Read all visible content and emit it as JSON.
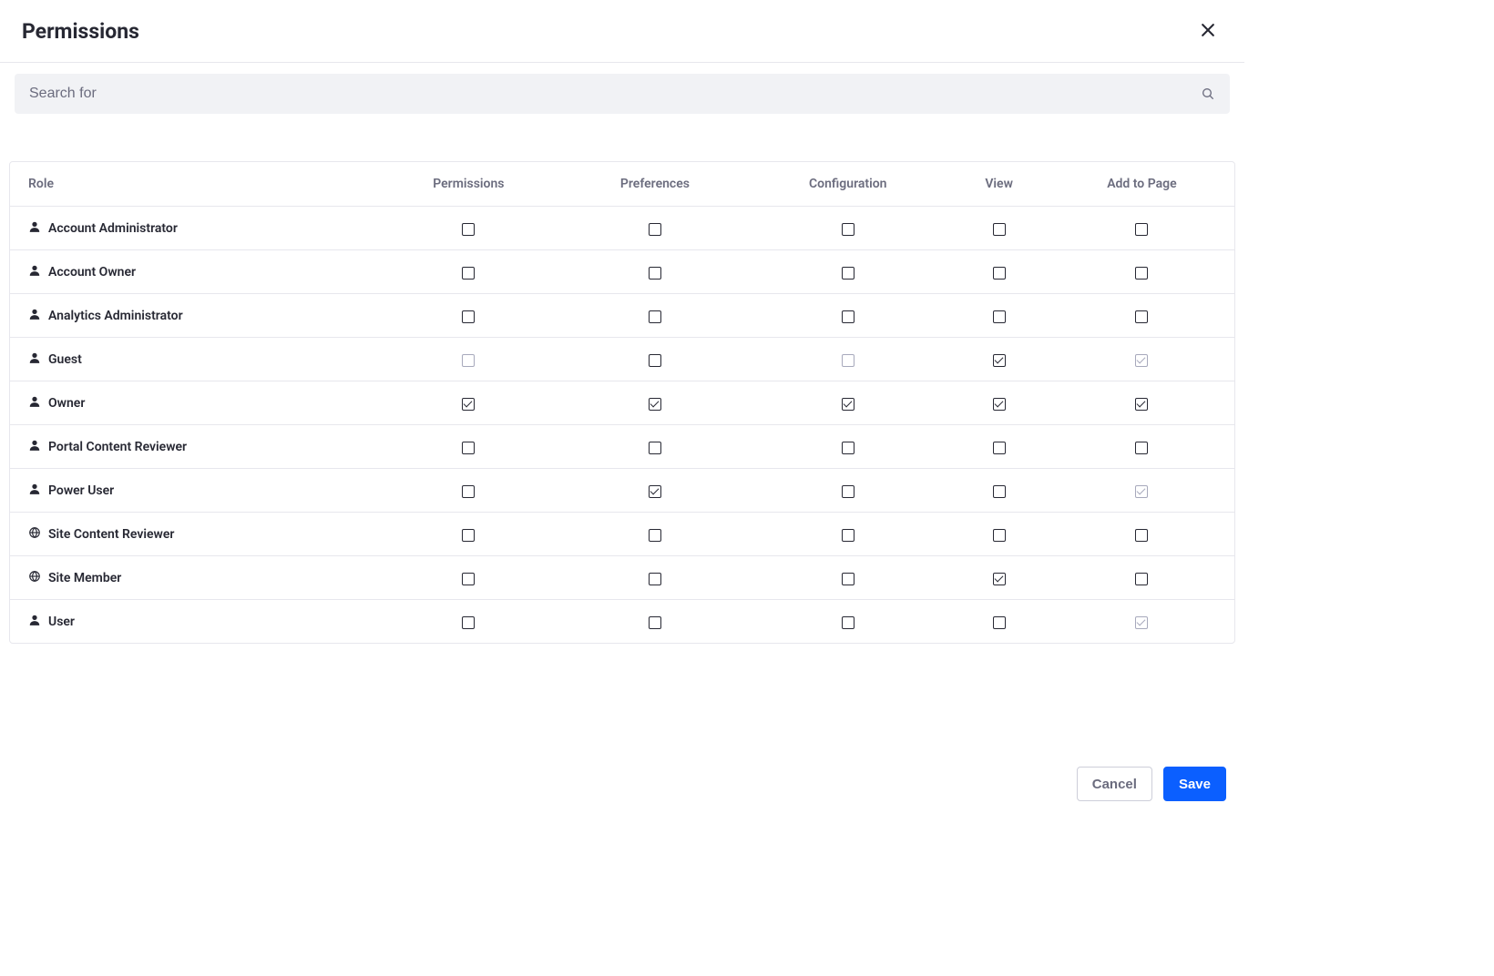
{
  "header": {
    "title": "Permissions"
  },
  "search": {
    "placeholder": "Search for"
  },
  "table": {
    "headers": [
      "Role",
      "Permissions",
      "Preferences",
      "Configuration",
      "View",
      "Add to Page"
    ],
    "rows": [
      {
        "icon": "user",
        "name": "Account Administrator",
        "cells": [
          {
            "checked": false,
            "disabled": false
          },
          {
            "checked": false,
            "disabled": false
          },
          {
            "checked": false,
            "disabled": false
          },
          {
            "checked": false,
            "disabled": false
          },
          {
            "checked": false,
            "disabled": false
          }
        ]
      },
      {
        "icon": "user",
        "name": "Account Owner",
        "cells": [
          {
            "checked": false,
            "disabled": false
          },
          {
            "checked": false,
            "disabled": false
          },
          {
            "checked": false,
            "disabled": false
          },
          {
            "checked": false,
            "disabled": false
          },
          {
            "checked": false,
            "disabled": false
          }
        ]
      },
      {
        "icon": "user",
        "name": "Analytics Administrator",
        "cells": [
          {
            "checked": false,
            "disabled": false
          },
          {
            "checked": false,
            "disabled": false
          },
          {
            "checked": false,
            "disabled": false
          },
          {
            "checked": false,
            "disabled": false
          },
          {
            "checked": false,
            "disabled": false
          }
        ]
      },
      {
        "icon": "user",
        "name": "Guest",
        "cells": [
          {
            "checked": false,
            "disabled": true
          },
          {
            "checked": false,
            "disabled": false
          },
          {
            "checked": false,
            "disabled": true
          },
          {
            "checked": true,
            "disabled": false
          },
          {
            "checked": true,
            "disabled": true
          }
        ]
      },
      {
        "icon": "user",
        "name": "Owner",
        "cells": [
          {
            "checked": true,
            "disabled": false
          },
          {
            "checked": true,
            "disabled": false
          },
          {
            "checked": true,
            "disabled": false
          },
          {
            "checked": true,
            "disabled": false
          },
          {
            "checked": true,
            "disabled": false
          }
        ]
      },
      {
        "icon": "user",
        "name": "Portal Content Reviewer",
        "cells": [
          {
            "checked": false,
            "disabled": false
          },
          {
            "checked": false,
            "disabled": false
          },
          {
            "checked": false,
            "disabled": false
          },
          {
            "checked": false,
            "disabled": false
          },
          {
            "checked": false,
            "disabled": false
          }
        ]
      },
      {
        "icon": "user",
        "name": "Power User",
        "cells": [
          {
            "checked": false,
            "disabled": false
          },
          {
            "checked": true,
            "disabled": false
          },
          {
            "checked": false,
            "disabled": false
          },
          {
            "checked": false,
            "disabled": false
          },
          {
            "checked": true,
            "disabled": true
          }
        ]
      },
      {
        "icon": "globe",
        "name": "Site Content Reviewer",
        "cells": [
          {
            "checked": false,
            "disabled": false
          },
          {
            "checked": false,
            "disabled": false
          },
          {
            "checked": false,
            "disabled": false
          },
          {
            "checked": false,
            "disabled": false
          },
          {
            "checked": false,
            "disabled": false
          }
        ]
      },
      {
        "icon": "globe",
        "name": "Site Member",
        "cells": [
          {
            "checked": false,
            "disabled": false
          },
          {
            "checked": false,
            "disabled": false
          },
          {
            "checked": false,
            "disabled": false
          },
          {
            "checked": true,
            "disabled": false
          },
          {
            "checked": false,
            "disabled": false
          }
        ]
      },
      {
        "icon": "user",
        "name": "User",
        "cells": [
          {
            "checked": false,
            "disabled": false
          },
          {
            "checked": false,
            "disabled": false
          },
          {
            "checked": false,
            "disabled": false
          },
          {
            "checked": false,
            "disabled": false
          },
          {
            "checked": true,
            "disabled": true
          }
        ]
      }
    ]
  },
  "footer": {
    "cancel": "Cancel",
    "save": "Save"
  }
}
